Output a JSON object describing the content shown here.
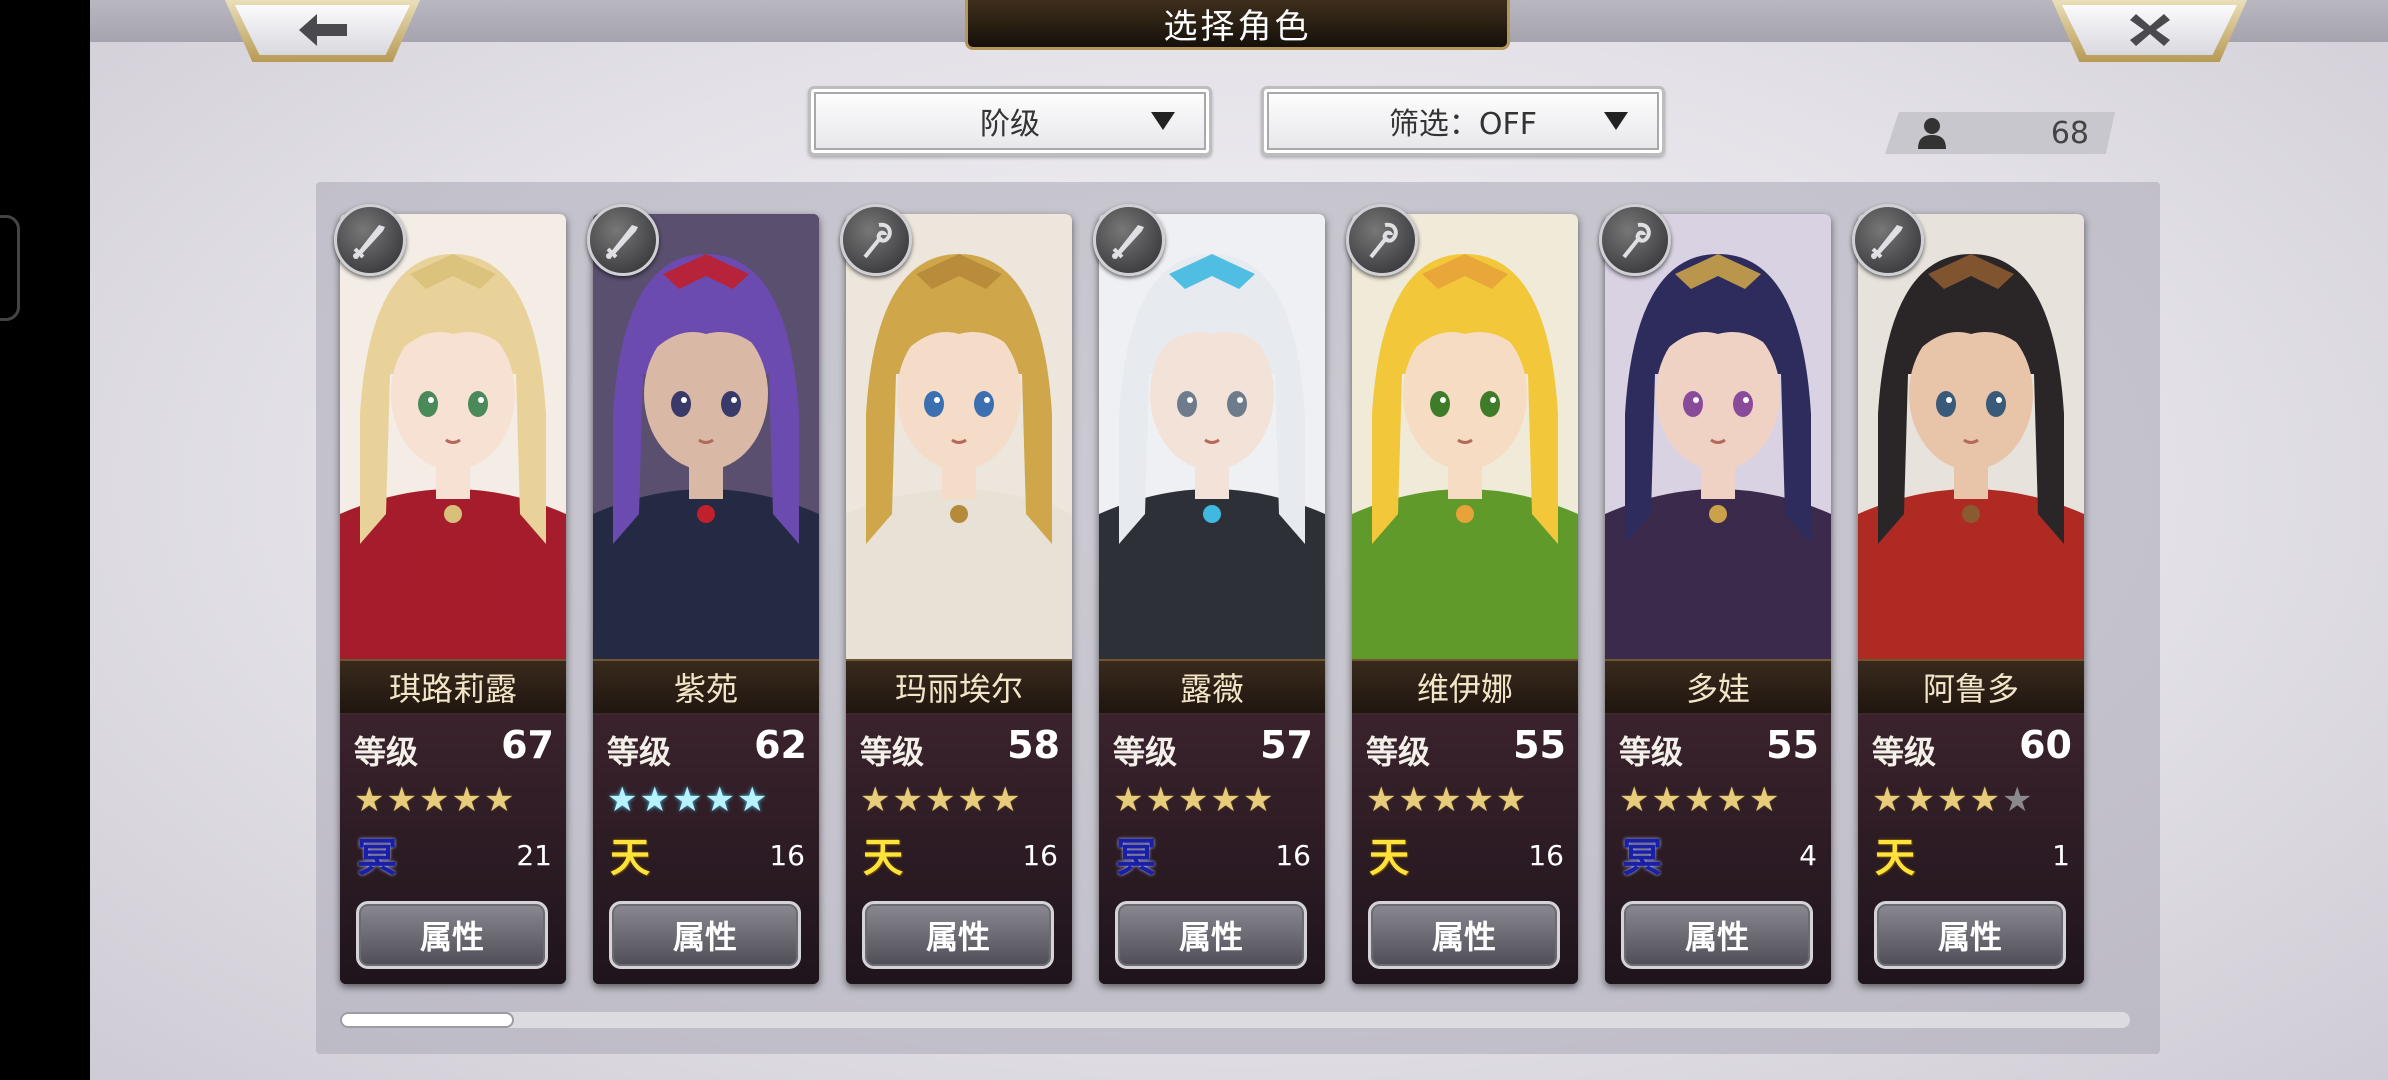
{
  "header": {
    "title": "选择角色",
    "back_icon": "arrow-left-icon",
    "close_icon": "close-x-icon"
  },
  "sort": {
    "label": "阶级"
  },
  "filter": {
    "label": "筛选：OFF"
  },
  "roster_count": "68",
  "level_label": "等级",
  "attr_label": "属性",
  "characters": [
    {
      "name": "琪路莉露",
      "level": "67",
      "stars": 5,
      "star_color": "gold",
      "rank": "冥",
      "rank_type": "ming",
      "count": "21",
      "weapon": "sword"
    },
    {
      "name": "紫苑",
      "level": "62",
      "stars": 5,
      "star_color": "cyan",
      "rank": "天",
      "rank_type": "tian",
      "count": "16",
      "weapon": "sword"
    },
    {
      "name": "玛丽埃尔",
      "level": "58",
      "stars": 5,
      "star_color": "gold",
      "rank": "天",
      "rank_type": "tian",
      "count": "16",
      "weapon": "staff"
    },
    {
      "name": "露薇",
      "level": "57",
      "stars": 5,
      "star_color": "gold",
      "rank": "冥",
      "rank_type": "ming",
      "count": "16",
      "weapon": "sword"
    },
    {
      "name": "维伊娜",
      "level": "55",
      "stars": 5,
      "star_color": "gold",
      "rank": "天",
      "rank_type": "tian",
      "count": "16",
      "weapon": "staff"
    },
    {
      "name": "多娃",
      "level": "55",
      "stars": 5,
      "star_color": "gold",
      "rank": "冥",
      "rank_type": "ming",
      "count": "4",
      "weapon": "staff"
    },
    {
      "name": "阿鲁多",
      "level": "60",
      "stars": 4,
      "star_color": "gold",
      "rank": "天",
      "rank_type": "tian",
      "count": "1",
      "weapon": "sword"
    }
  ],
  "scroll_position": 0.0
}
